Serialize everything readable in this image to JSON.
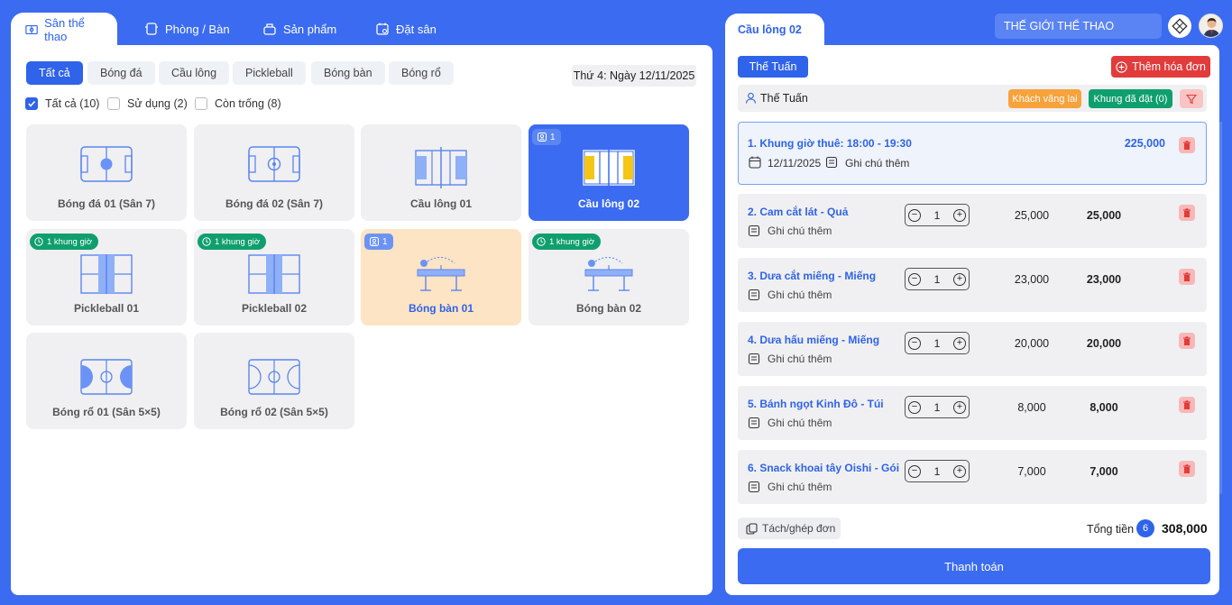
{
  "top_tabs": [
    {
      "label": "Sân thể thao",
      "icon": "court-icon"
    },
    {
      "label": "Phòng / Bàn",
      "icon": "table-icon"
    },
    {
      "label": "Sản phẩm",
      "icon": "product-icon"
    },
    {
      "label": "Đặt sân",
      "icon": "calendar-icon"
    }
  ],
  "categories": [
    "Tất cả",
    "Bóng đá",
    "Cầu lông",
    "Pickleball",
    "Bóng bàn",
    "Bóng rổ"
  ],
  "date_label": "Thứ 4: Ngày 12/11/2025",
  "filters": [
    {
      "label": "Tất cả (10)",
      "checked": true
    },
    {
      "label": "Sử dụng (2)",
      "checked": false
    },
    {
      "label": "Còn trống (8)",
      "checked": false
    }
  ],
  "courts": [
    {
      "name": "Bóng đá 01 (Sân 7)",
      "type": "football",
      "state": "free"
    },
    {
      "name": "Bóng đá 02 (Sân 7)",
      "type": "football",
      "state": "free"
    },
    {
      "name": "Cầu lông 01",
      "type": "badminton",
      "state": "free"
    },
    {
      "name": "Cầu lông 02",
      "type": "badminton",
      "state": "selected",
      "badge_user": "1"
    },
    {
      "name": "Pickleball 01",
      "type": "pickleball",
      "state": "free",
      "badge_time": "1 khung giờ"
    },
    {
      "name": "Pickleball 02",
      "type": "pickleball",
      "state": "free",
      "badge_time": "1 khung giờ"
    },
    {
      "name": "Bóng bàn 01",
      "type": "pingpong",
      "state": "busy",
      "badge_user": "1"
    },
    {
      "name": "Bóng bàn 02",
      "type": "pingpong",
      "state": "free",
      "badge_time": "1 khung giờ"
    },
    {
      "name": "Bóng rổ 01 (Sân 5×5)",
      "type": "basketball",
      "state": "free"
    },
    {
      "name": "Bóng rổ 02 (Sân 5×5)",
      "type": "basketball",
      "state": "free"
    }
  ],
  "right": {
    "tab_label": "Cầu lông 02",
    "search_text": "THẾ GIỚI THỂ THAO",
    "customer_tab": "Thế Tuấn",
    "add_invoice": "Thêm hóa đơn",
    "customer_name": "Thế Tuấn",
    "walk_in": "Khách vãng lai",
    "booked_slots": "Khung đã đặt (0)",
    "slot": {
      "title": "1. Khung giờ thuê: 18:00 - 19:30",
      "price": "225,000",
      "date": "12/11/2025",
      "note": "Ghi chú thêm"
    },
    "items": [
      {
        "name": "2. Cam cắt lát - Quả",
        "qty": "1",
        "price": "25,000",
        "total": "25,000",
        "note": "Ghi chú thêm"
      },
      {
        "name": "3. Dưa cắt miếng - Miếng",
        "qty": "1",
        "price": "23,000",
        "total": "23,000",
        "note": "Ghi chú thêm"
      },
      {
        "name": "4. Dưa hấu miếng - Miếng",
        "qty": "1",
        "price": "20,000",
        "total": "20,000",
        "note": "Ghi chú thêm"
      },
      {
        "name": "5. Bánh ngọt Kinh Đô - Túi",
        "qty": "1",
        "price": "8,000",
        "total": "8,000",
        "note": "Ghi chú thêm"
      },
      {
        "name": "6. Snack khoai tây Oishi - Gói",
        "qty": "1",
        "price": "7,000",
        "total": "7,000",
        "note": "Ghi chú thêm"
      }
    ],
    "split_merge": "Tách/ghép đơn",
    "total_label": "Tổng tiền",
    "item_count": "6",
    "total_amount": "308,000",
    "pay_button": "Thanh toán"
  },
  "colors": {
    "primary": "#2f63e9",
    "background": "#3b6bf0",
    "green": "#0f9f6e",
    "orange": "#f7a23b",
    "red": "#e23b3b"
  }
}
